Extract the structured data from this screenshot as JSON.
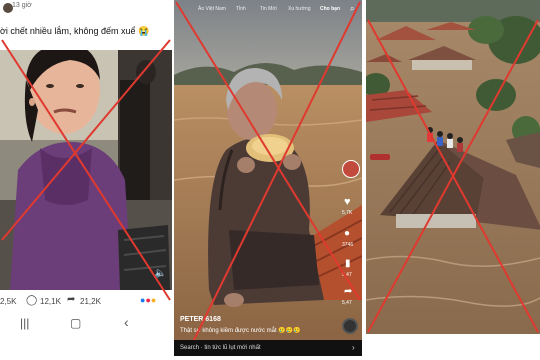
{
  "facebook_post": {
    "time": "13 giờ",
    "caption": "ời chết nhiều lắm, không đếm xuể 😭",
    "reactions_count": "2,5K",
    "comments_count": "12,1K",
    "shares_count": "21,2K"
  },
  "tiktok_video": {
    "top_nav": [
      "Ảo Việt Nam",
      "Tỉnh",
      "Tin Mới",
      "Xu hướng",
      "Cho bạn"
    ],
    "username": "PETER 6168",
    "caption": "Thật sự không kiềm được nước mắt 🥲🥲🥲",
    "side_counts": {
      "likes": "5,7K",
      "comments": "3746",
      "saves": "5,47",
      "shares": "5,47"
    },
    "search_bar": "Search · tin tức lũ lụt mới nhất"
  },
  "colors": {
    "fake_cross": "#e0392f",
    "facebook_blue": "#1877f2"
  }
}
